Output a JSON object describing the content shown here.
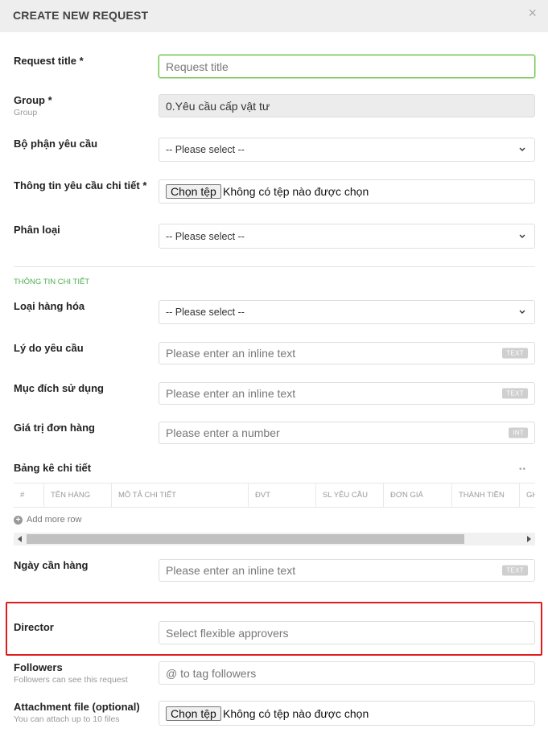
{
  "dialog": {
    "title": "CREATE NEW REQUEST",
    "close_glyph": "×"
  },
  "fields": {
    "request_title": {
      "label": "Request title *",
      "placeholder": "Request title"
    },
    "group": {
      "label": "Group *",
      "sublabel": "Group",
      "value": "0.Yêu cầu cấp vật tư"
    },
    "department": {
      "label": "Bộ phận yêu cầu",
      "value": "-- Please select --"
    },
    "detail_info": {
      "label": "Thông tin yêu cầu chi tiết *",
      "button": "Chọn tệp",
      "status": "Không có tệp nào được chọn"
    },
    "category": {
      "label": "Phân loại",
      "value": "-- Please select --"
    }
  },
  "details_section": {
    "title": "THÔNG TIN CHI TIẾT",
    "goods_type": {
      "label": "Loại hàng hóa",
      "value": "-- Please select --"
    },
    "reason": {
      "label": "Lý do yêu cầu",
      "placeholder": "Please enter an inline text",
      "badge": "TEXT"
    },
    "purpose": {
      "label": "Mục đích sử dụng",
      "placeholder": "Please enter an inline text",
      "badge": "TEXT"
    },
    "order_value": {
      "label": "Giá trị đơn hàng",
      "placeholder": "Please enter a number",
      "badge": "INT"
    },
    "table": {
      "label": "Bảng kê chi tiết",
      "menu_glyph": "••",
      "columns": [
        "#",
        "TÊN HÀNG",
        "MÔ TẢ CHI TIẾT",
        "ĐVT",
        "SL YÊU CẦU",
        "ĐƠN GIÁ",
        "THÀNH TIỀN",
        "GH"
      ],
      "add_row": "Add more row"
    },
    "needed_date": {
      "label": "Ngày cần hàng",
      "placeholder": "Please enter an inline text",
      "badge": "TEXT"
    }
  },
  "director": {
    "label": "Director",
    "placeholder": "Select flexible approvers"
  },
  "followers": {
    "label": "Followers",
    "sublabel": "Followers can see this request",
    "placeholder": "@ to tag followers"
  },
  "attachment": {
    "label": "Attachment file (optional)",
    "sublabel": "You can attach up to 10 files",
    "button": "Chọn tệp",
    "status": "Không có tệp nào được chọn"
  },
  "colors": {
    "accent_green": "#4caf50",
    "focus_green": "#6cc24a",
    "highlight_red": "#e01b1b"
  }
}
